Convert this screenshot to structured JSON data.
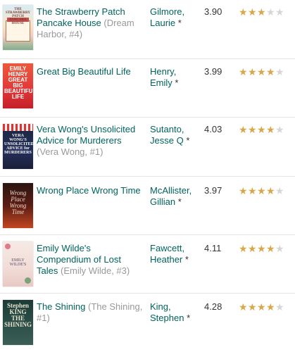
{
  "colors": {
    "link": "#00635d",
    "series": "#999999",
    "star_filled": "#e87400",
    "star_filled_alt": "#d7a74a",
    "star_empty": "#d6d6d6"
  },
  "books": [
    {
      "title": "The Strawberry Patch Pancake House",
      "series": "(Dream Harbor, #4)",
      "author": "Gilmore, Laurie",
      "author_mark": "*",
      "avg_rating": "3.90",
      "stars_filled": 3,
      "cover_text": "THE STRAWBERRY PATCH PANCAKE HOUSE"
    },
    {
      "title": "Great Big Beautiful Life",
      "series": "",
      "author": "Henry, Emily",
      "author_mark": "*",
      "avg_rating": "3.99",
      "stars_filled": 4,
      "cover_text": "EMILY HENRY GREAT BIG BEAUTIFUL LIFE"
    },
    {
      "title": "Vera Wong's Unsolicited Advice for Murderers",
      "series": "(Vera Wong, #1)",
      "author": "Sutanto, Jesse Q",
      "author_mark": "*",
      "avg_rating": "4.03",
      "stars_filled": 4,
      "cover_text": "VERA WONG'S UNSOLICITED ADVICE for MURDERERS"
    },
    {
      "title": "Wrong Place Wrong Time",
      "series": "",
      "author": "McAllister, Gillian",
      "author_mark": "*",
      "avg_rating": "3.97",
      "stars_filled": 4,
      "cover_text": "Wrong Place Wrong Time"
    },
    {
      "title": "Emily Wilde's Compendium of Lost Tales",
      "series": "(Emily Wilde, #3)",
      "author": "Fawcett, Heather",
      "author_mark": "*",
      "avg_rating": "4.11",
      "stars_filled": 4,
      "cover_text": "EMILY WILDE'S"
    },
    {
      "title": "The Shining",
      "series": "(The Shining, #1)",
      "author": "King, Stephen",
      "author_mark": "*",
      "avg_rating": "4.28",
      "stars_filled": 4,
      "cover_text": "Stephen KING THE SHINING"
    }
  ]
}
